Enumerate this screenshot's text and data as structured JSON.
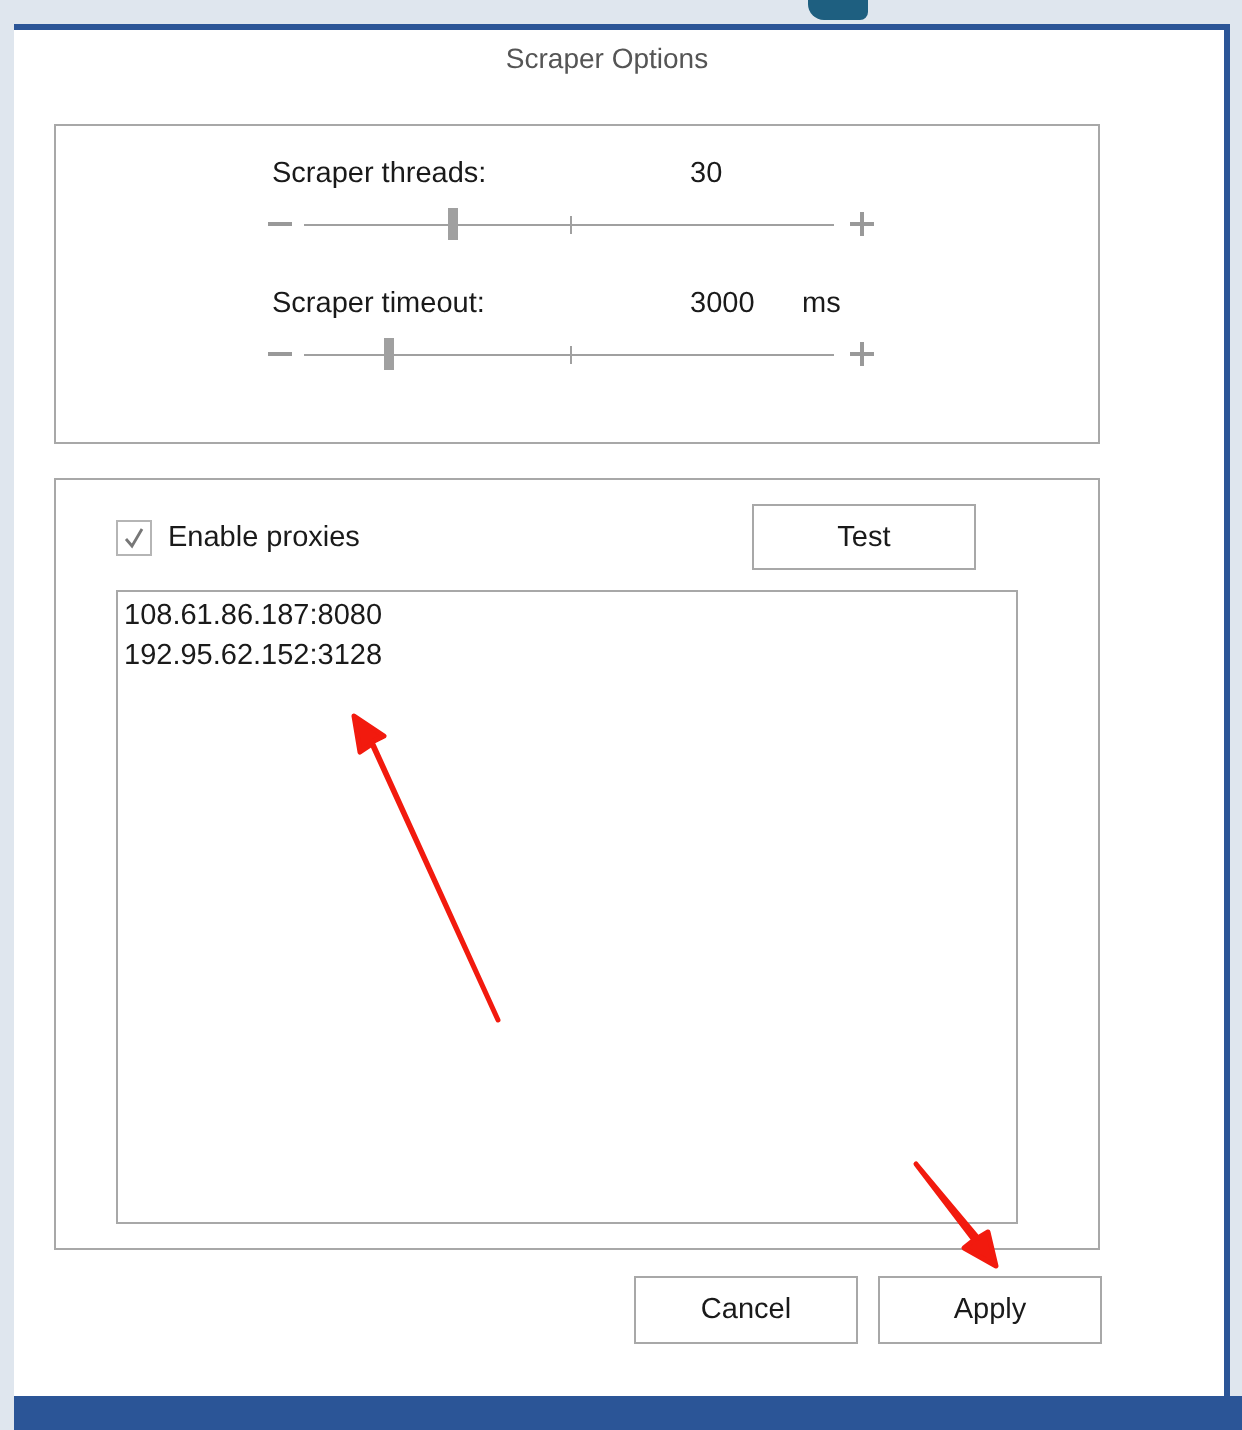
{
  "dialog": {
    "title": "Scraper Options"
  },
  "sliders": [
    {
      "label": "Scraper threads:",
      "value": "30",
      "level": 0.28
    },
    {
      "label": "Scraper timeout:",
      "value": "3000",
      "unit": "ms",
      "level": 0.16
    }
  ],
  "proxies": {
    "enable": {
      "label": "Enable proxies",
      "checked": true
    },
    "test_button": "Test",
    "list": [
      "108.61.86.187:8080",
      "192.95.62.152:3128"
    ]
  },
  "buttons": [
    "Cancel",
    "Apply"
  ]
}
